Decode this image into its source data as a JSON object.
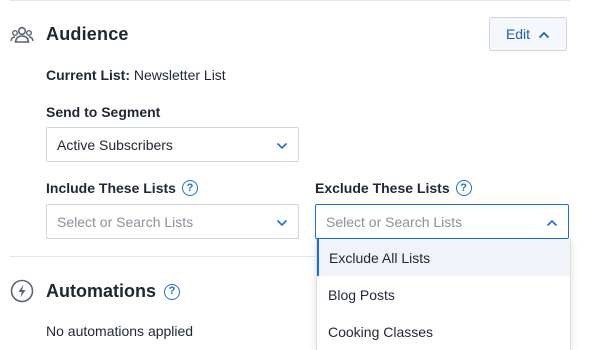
{
  "audience": {
    "title": "Audience",
    "edit_label": "Edit",
    "current_list_label": "Current List:",
    "current_list_value": "Newsletter List",
    "segment_label": "Send to Segment",
    "segment_value": "Active Subscribers",
    "include_label": "Include These Lists",
    "include_placeholder": "Select or Search Lists",
    "exclude_label": "Exclude These Lists",
    "exclude_placeholder": "Select or Search Lists",
    "exclude_options": [
      "Exclude All Lists",
      "Blog Posts",
      "Cooking Classes"
    ]
  },
  "automations": {
    "title": "Automations",
    "empty_text": "No automations applied"
  },
  "colors": {
    "accent": "#1d6fd8",
    "text": "#1f2733",
    "icon": "#5b6472"
  },
  "icons": [
    "users-icon",
    "chevron-up-icon",
    "chevron-down-icon",
    "help-icon",
    "bolt-icon"
  ]
}
